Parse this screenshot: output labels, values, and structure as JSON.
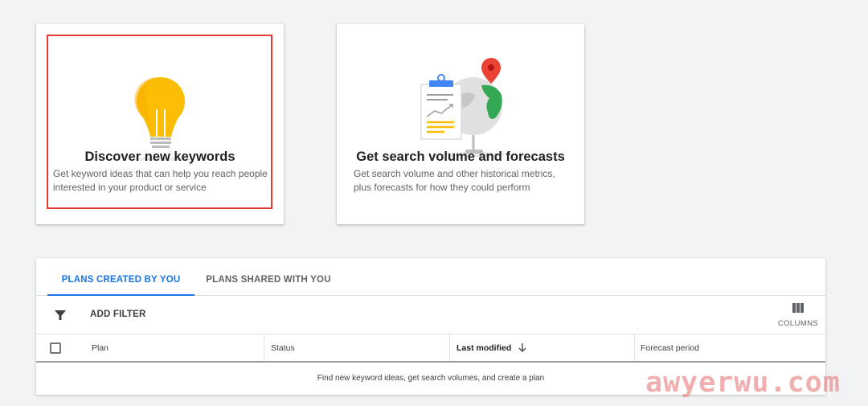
{
  "cards": {
    "discover": {
      "title": "Discover new keywords",
      "description": "Get keyword ideas that can help you reach people interested in your product or service",
      "icon": "lightbulb-icon"
    },
    "forecast": {
      "title": "Get search volume and forecasts",
      "description": "Get search volume and other historical metrics, plus forecasts for how they could perform",
      "icon": "clipboard-globe-icon"
    }
  },
  "tabs": {
    "created": "PLANS CREATED BY YOU",
    "shared": "PLANS SHARED WITH YOU"
  },
  "toolbar": {
    "add_filter": "ADD FILTER",
    "columns": "COLUMNS"
  },
  "table": {
    "columns": [
      "Plan",
      "Status",
      "Last modified",
      "Forecast period"
    ],
    "empty_message": "Find new keyword ideas, get search volumes, and create a plan"
  },
  "watermark": "awyerwu.com",
  "colors": {
    "accent": "#1a73e8",
    "highlight": "#e53935",
    "bulb": "#fbbc04"
  }
}
